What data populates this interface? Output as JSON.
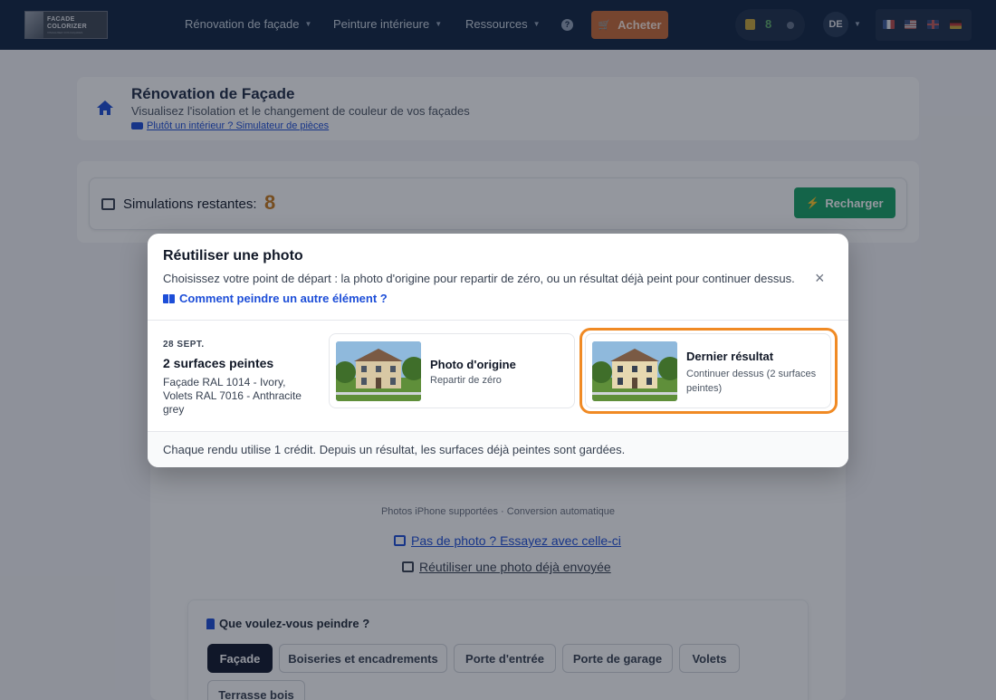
{
  "navbar": {
    "logo_line1": "FACADE",
    "logo_line2": "COLORIZER",
    "logo_tagline": "VISUALISEZ VOS FAÇADES",
    "menu": [
      {
        "label": "Rénovation de façade"
      },
      {
        "label": "Peinture intérieure"
      },
      {
        "label": "Ressources"
      }
    ],
    "help_icon": "?",
    "buy_label": "Acheter",
    "credits": "8",
    "user_initials": "DE",
    "languages": [
      "fr",
      "us",
      "gb",
      "de"
    ]
  },
  "header": {
    "title": "Rénovation de Façade",
    "subtitle": "Visualisez l'isolation et le changement de couleur de vos façades",
    "link": "Plutôt un intérieur ? Simulateur de pièces"
  },
  "simulations": {
    "label": "Simulations restantes:",
    "count": "8",
    "recharge_label": "Recharger"
  },
  "upload": {
    "hint": "Photos iPhone supportées · Conversion automatique",
    "try_link": "Pas de photo ? Essayez avec celle-ci",
    "reuse_link": "Réutiliser une photo déjà envoyée"
  },
  "paint": {
    "title": "Que voulez-vous peindre ?",
    "tabs": [
      {
        "label": "Façade",
        "active": true
      },
      {
        "label": "Boiseries et encadrements"
      },
      {
        "label": "Porte d'entrée"
      },
      {
        "label": "Porte de garage"
      },
      {
        "label": "Volets"
      },
      {
        "label": "Terrasse bois"
      }
    ]
  },
  "modal": {
    "title": "Réutiliser une photo",
    "description": "Choisissez votre point de départ : la photo d'origine pour repartir de zéro, ou un résultat déjà peint pour continuer dessus.",
    "help_link": "Comment peindre un autre élément ?",
    "close_icon": "×",
    "session": {
      "date": "28 SEPT.",
      "title": "2 surfaces peintes",
      "detail": "Façade RAL 1014 - Ivory, Volets RAL 7016 - Anthracite grey"
    },
    "options": [
      {
        "name": "Photo d'origine",
        "desc": "Repartir de zéro"
      },
      {
        "name": "Dernier résultat",
        "desc": "Continuer dessus (2 surfaces peintes)",
        "highlighted": true
      }
    ],
    "footer": "Chaque rendu utilise 1 crédit. Depuis un résultat, les surfaces déjà peintes sont gardées."
  },
  "colors": {
    "navbar_bg": "#0f2340",
    "buy_button": "#c96a35",
    "recharge_button": "#16a364",
    "link_blue": "#1d4ed8",
    "highlight_orange": "#f08a24",
    "credit_count": "#c97a1d"
  }
}
